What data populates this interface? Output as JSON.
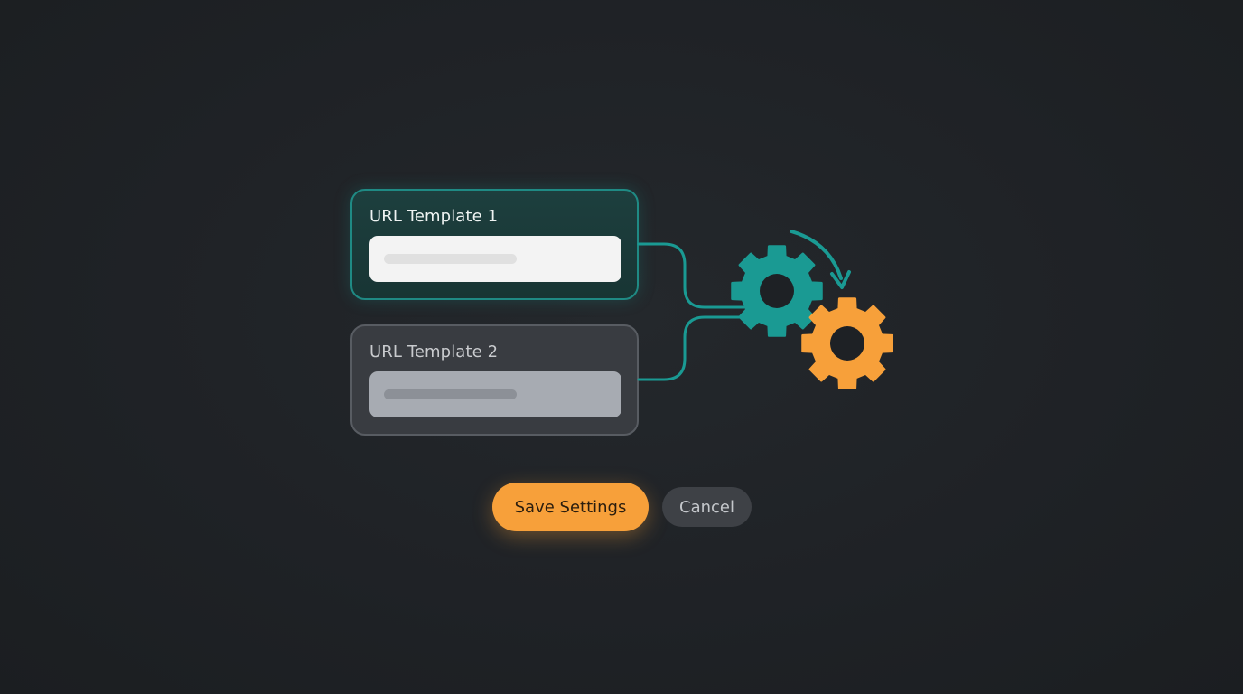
{
  "templates": [
    {
      "label": "URL Template 1",
      "state": "active",
      "value": ""
    },
    {
      "label": "URL Template 2",
      "state": "inactive",
      "value": ""
    }
  ],
  "actions": {
    "save_label": "Save Settings",
    "cancel_label": "Cancel"
  },
  "icons": {
    "primary_gear": "gear-icon",
    "secondary_gear": "gear-icon",
    "rotation": "rotate-arrow-icon"
  },
  "colors": {
    "accent_teal": "#1a9a93",
    "accent_orange": "#f7a03a",
    "background": "#1e2125"
  }
}
